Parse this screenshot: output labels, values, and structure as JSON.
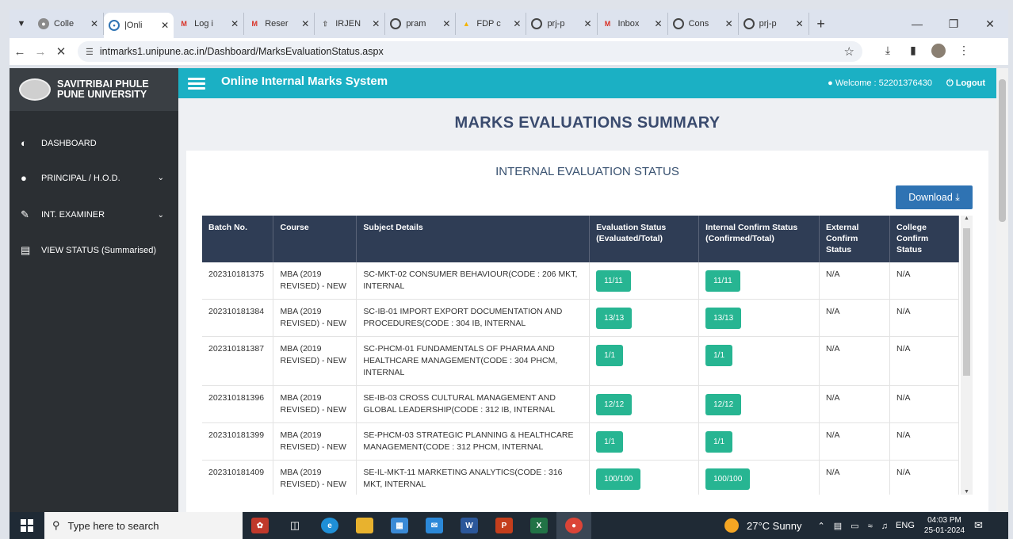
{
  "browser": {
    "tabs": [
      {
        "title": "Colle",
        "icon": "college-icon",
        "active": false
      },
      {
        "title": "|Onli",
        "icon": "online-icon",
        "active": true
      },
      {
        "title": "Log i",
        "icon": "gmail-icon",
        "active": false
      },
      {
        "title": "Reser",
        "icon": "gmail-icon",
        "active": false
      },
      {
        "title": "IRJEN",
        "icon": "upload-icon",
        "active": false
      },
      {
        "title": "pram",
        "icon": "globe-icon",
        "active": false
      },
      {
        "title": "FDP c",
        "icon": "drive-icon",
        "active": false
      },
      {
        "title": "prj-p",
        "icon": "globe-icon",
        "active": false
      },
      {
        "title": "Inbox",
        "icon": "gmail-icon",
        "active": false
      },
      {
        "title": "Cons",
        "icon": "globe-icon",
        "active": false
      },
      {
        "title": "prj-p",
        "icon": "globe-icon",
        "active": false
      }
    ],
    "url": "intmarks1.unipune.ac.in/Dashboard/MarksEvaluationStatus.aspx"
  },
  "sidebar": {
    "brand_line1": "SAVITRIBAI PHULE",
    "brand_line2": "PUNE UNIVERSITY",
    "items": [
      {
        "label": "DASHBOARD",
        "icon": "dashboard-icon"
      },
      {
        "label": "PRINCIPAL / H.O.D.",
        "icon": "user-icon"
      },
      {
        "label": "INT. EXAMINER",
        "icon": "edit-icon"
      },
      {
        "label": "VIEW STATUS (Summarised)",
        "icon": "list-icon"
      }
    ]
  },
  "header": {
    "title": "Online Internal Marks System",
    "welcome": "Welcome : 52201376430",
    "logout": "Logout"
  },
  "main": {
    "page_title": "MARKS EVALUATIONS SUMMARY",
    "card_title": "INTERNAL EVALUATION STATUS",
    "download_label": "Download"
  },
  "table": {
    "headers": [
      "Batch No.",
      "Course",
      "Subject Details",
      "Evaluation Status (Evaluated/Total)",
      "Internal Confirm Status (Confirmed/Total)",
      "External Confirm Status",
      "College Confirm Status"
    ],
    "rows": [
      {
        "batch": "202310181375",
        "course": "MBA (2019 REVISED) - NEW",
        "subject": "SC-MKT-02 CONSUMER BEHAVIOUR(CODE : 206 MKT, INTERNAL",
        "eval": "11/11",
        "internal": "11/11",
        "external": "N/A",
        "college": "N/A"
      },
      {
        "batch": "202310181384",
        "course": "MBA (2019 REVISED) - NEW",
        "subject": "SC-IB-01 IMPORT EXPORT DOCUMENTATION AND PROCEDURES(CODE : 304 IB, INTERNAL",
        "eval": "13/13",
        "internal": "13/13",
        "external": "N/A",
        "college": "N/A"
      },
      {
        "batch": "202310181387",
        "course": "MBA (2019 REVISED) - NEW",
        "subject": "SC-PHCM-01 FUNDAMENTALS OF PHARMA AND HEALTHCARE MANAGEMENT(CODE : 304 PHCM, INTERNAL",
        "eval": "1/1",
        "internal": "1/1",
        "external": "N/A",
        "college": "N/A"
      },
      {
        "batch": "202310181396",
        "course": "MBA (2019 REVISED) - NEW",
        "subject": "SE-IB-03 CROSS CULTURAL MANAGEMENT AND GLOBAL LEADERSHIP(CODE : 312 IB, INTERNAL",
        "eval": "12/12",
        "internal": "12/12",
        "external": "N/A",
        "college": "N/A"
      },
      {
        "batch": "202310181399",
        "course": "MBA (2019 REVISED) - NEW",
        "subject": "SE-PHCM-03 STRATEGIC PLANNING & HEALTHCARE MANAGEMENT(CODE : 312 PHCM, INTERNAL",
        "eval": "1/1",
        "internal": "1/1",
        "external": "N/A",
        "college": "N/A"
      },
      {
        "batch": "202310181409",
        "course": "MBA (2019 REVISED) - NEW",
        "subject": "SE-IL-MKT-11 MARKETING ANALYTICS(CODE : 316 MKT, INTERNAL",
        "eval": "100/100",
        "internal": "100/100",
        "external": "N/A",
        "college": "N/A"
      }
    ]
  },
  "taskbar": {
    "search_placeholder": "Type here to search",
    "weather": "27°C  Sunny",
    "lang": "ENG",
    "time": "04:03 PM",
    "date": "25-01-2024"
  },
  "colors": {
    "accent": "#1bb0c4",
    "badge": "#27b592",
    "table_header": "#2f3d55",
    "download": "#2f73b3",
    "sidebar": "#2b2f33"
  }
}
